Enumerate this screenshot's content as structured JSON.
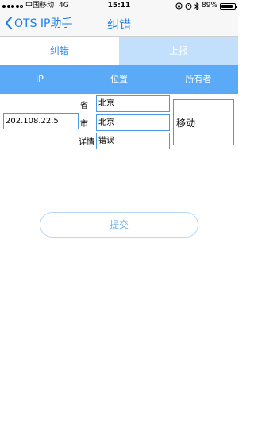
{
  "status": {
    "carrier": "中国移动",
    "network": "4G",
    "time": "15:11",
    "battery_pct": "89%",
    "battery_level": 0.89
  },
  "nav": {
    "back_label": "OTS IP助手",
    "title": "纠错"
  },
  "tabs": [
    {
      "label": "纠错",
      "active": true
    },
    {
      "label": "上报",
      "active": false
    }
  ],
  "table_headers": [
    "IP",
    "位置",
    "所有者"
  ],
  "form": {
    "ip_value": "202.108.22.5",
    "province_label": "省",
    "province_value": "北京",
    "city_label": "市",
    "city_value": "北京",
    "detail_label": "详情",
    "detail_value": "错误",
    "owner_value": "移动"
  },
  "submit_label": "提交",
  "colors": {
    "accent": "#1a7ef0",
    "header_bg": "#5aaaf7",
    "inactive_tab_bg": "#c2e0fb"
  }
}
